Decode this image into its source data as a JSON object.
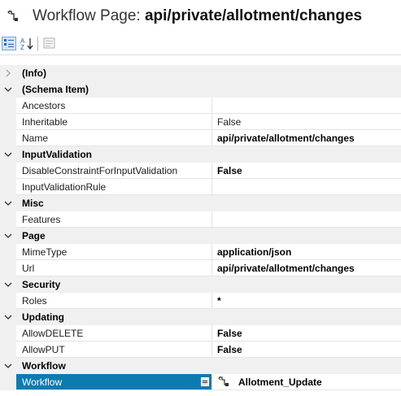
{
  "header": {
    "title_prefix": "Workflow Page:",
    "title_name": "api/private/allotment/changes",
    "icon": "workflow-icon"
  },
  "toolbar": {
    "buttons": [
      "categorized-icon",
      "alphabetical-icon",
      "property-pages-icon"
    ]
  },
  "grid": {
    "info": "(Info)",
    "schema_item": "(Schema Item)",
    "ancestors": "Ancestors",
    "inheritable": "Inheritable",
    "inheritable_value": "False",
    "name": "Name",
    "name_value": "api/private/allotment/changes",
    "input_validation": "InputValidation",
    "disable_constraint": "DisableConstraintForInputValidation",
    "disable_constraint_value": "False",
    "input_validation_rule": "InputValidationRule",
    "misc": "Misc",
    "features": "Features",
    "page": "Page",
    "mime_type": "MimeType",
    "mime_type_value": "application/json",
    "url": "Url",
    "url_value": "api/private/allotment/changes",
    "security": "Security",
    "roles": "Roles",
    "roles_value": "*",
    "updating": "Updating",
    "allow_delete": "AllowDELETE",
    "allow_delete_value": "False",
    "allow_put": "AllowPUT",
    "allow_put_value": "False",
    "workflow_cat": "Workflow",
    "workflow": "Workflow",
    "workflow_value": "Allotment_Update"
  },
  "colors": {
    "selection": "#0e7bb0",
    "category_bg": "#f0f0f0",
    "grid_line": "#e4e4e4"
  }
}
